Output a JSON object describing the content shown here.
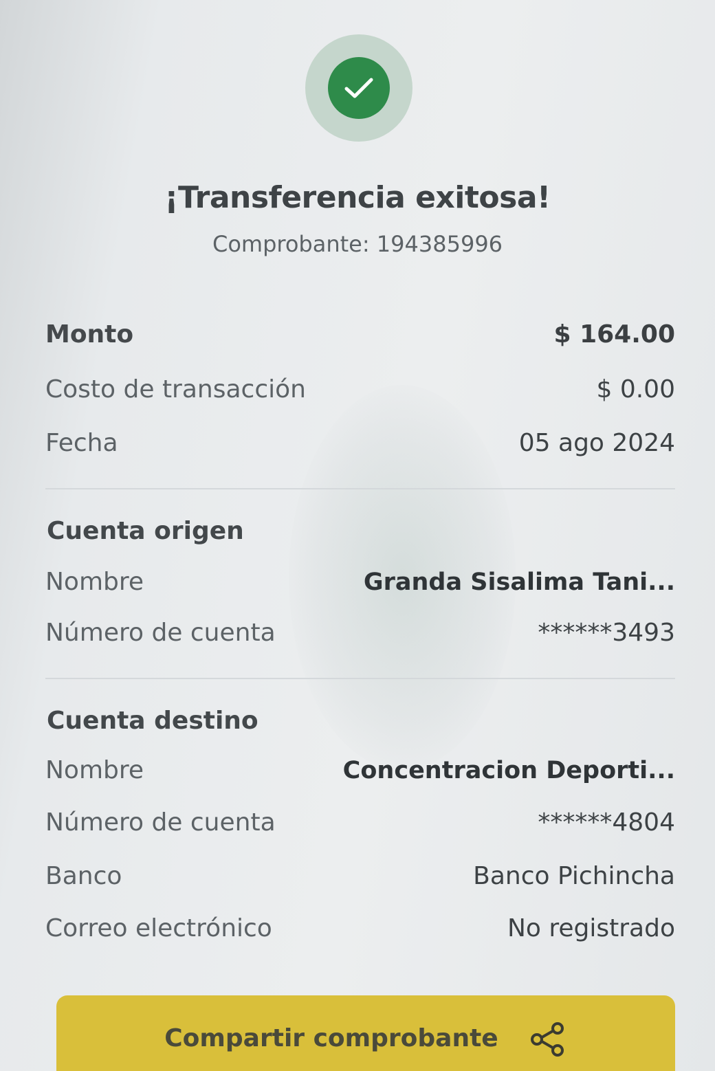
{
  "header": {
    "title": "¡Transferencia exitosa!",
    "voucher": "Comprobante: 194385996",
    "status_icon": "check-icon",
    "status_color": "#2e8b4a"
  },
  "summary": {
    "amount_label": "Monto",
    "amount_value": "$ 164.00",
    "fee_label": "Costo de transacción",
    "fee_value": "$ 0.00",
    "date_label": "Fecha",
    "date_value": "05 ago 2024"
  },
  "origin": {
    "section_title": "Cuenta origen",
    "name_label": "Nombre",
    "name_value": "Granda  Sisalima Tani...",
    "account_label": "Número de cuenta",
    "account_value": "******3493"
  },
  "destination": {
    "section_title": "Cuenta destino",
    "name_label": "Nombre",
    "name_value": "Concentracion Deporti...",
    "account_label": "Número de cuenta",
    "account_value": "******4804",
    "bank_label": "Banco",
    "bank_value": "Banco Pichincha",
    "email_label": "Correo electrónico",
    "email_value": "No registrado"
  },
  "actions": {
    "share_label": "Compartir comprobante",
    "share_icon": "share-icon",
    "button_color": "#d9bf3a"
  }
}
